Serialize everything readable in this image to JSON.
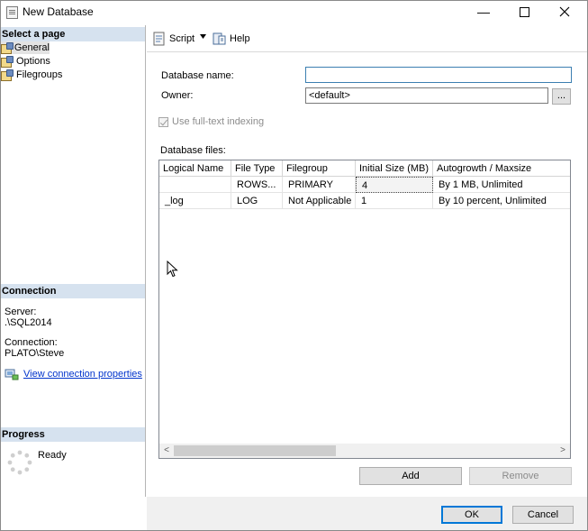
{
  "window": {
    "title": "New Database",
    "minimize_glyph": "—",
    "maximize_glyph": "☐",
    "close_glyph": "✕"
  },
  "left_pane": {
    "select_page_header": "Select a page",
    "pages": [
      {
        "label": "General",
        "icon": "wrench-page-icon",
        "selected": true
      },
      {
        "label": "Options",
        "icon": "wrench-page-icon",
        "selected": false
      },
      {
        "label": "Filegroups",
        "icon": "wrench-page-icon",
        "selected": false
      }
    ],
    "connection_header": "Connection",
    "server_label": "Server:",
    "server_value": ".\\SQL2014",
    "connection_label": "Connection:",
    "connection_value": "PLATO\\Steve",
    "view_connection_link": "View connection properties",
    "progress_header": "Progress",
    "progress_status": "Ready"
  },
  "toolbar": {
    "script_label": "Script",
    "help_label": "Help"
  },
  "form": {
    "database_name_label": "Database name:",
    "database_name_value": "",
    "owner_label": "Owner:",
    "owner_value": "<default>",
    "browse_label": "...",
    "fulltext_label": "Use full-text indexing",
    "fulltext_checked": true,
    "fulltext_enabled": false,
    "database_files_label": "Database files:"
  },
  "files_grid": {
    "columns": [
      "Logical Name",
      "File Type",
      "Filegroup",
      "Initial Size (MB)",
      "Autogrowth / Maxsize"
    ],
    "rows": [
      [
        "",
        "ROWS...",
        "PRIMARY",
        "4",
        "By 1 MB, Unlimited"
      ],
      [
        "_log",
        "LOG",
        "Not Applicable",
        "1",
        "By 10 percent, Unlimited"
      ]
    ],
    "scroll_left": "<",
    "scroll_right": ">"
  },
  "buttons": {
    "add": "Add",
    "remove": "Remove",
    "ok": "OK",
    "cancel": "Cancel"
  }
}
